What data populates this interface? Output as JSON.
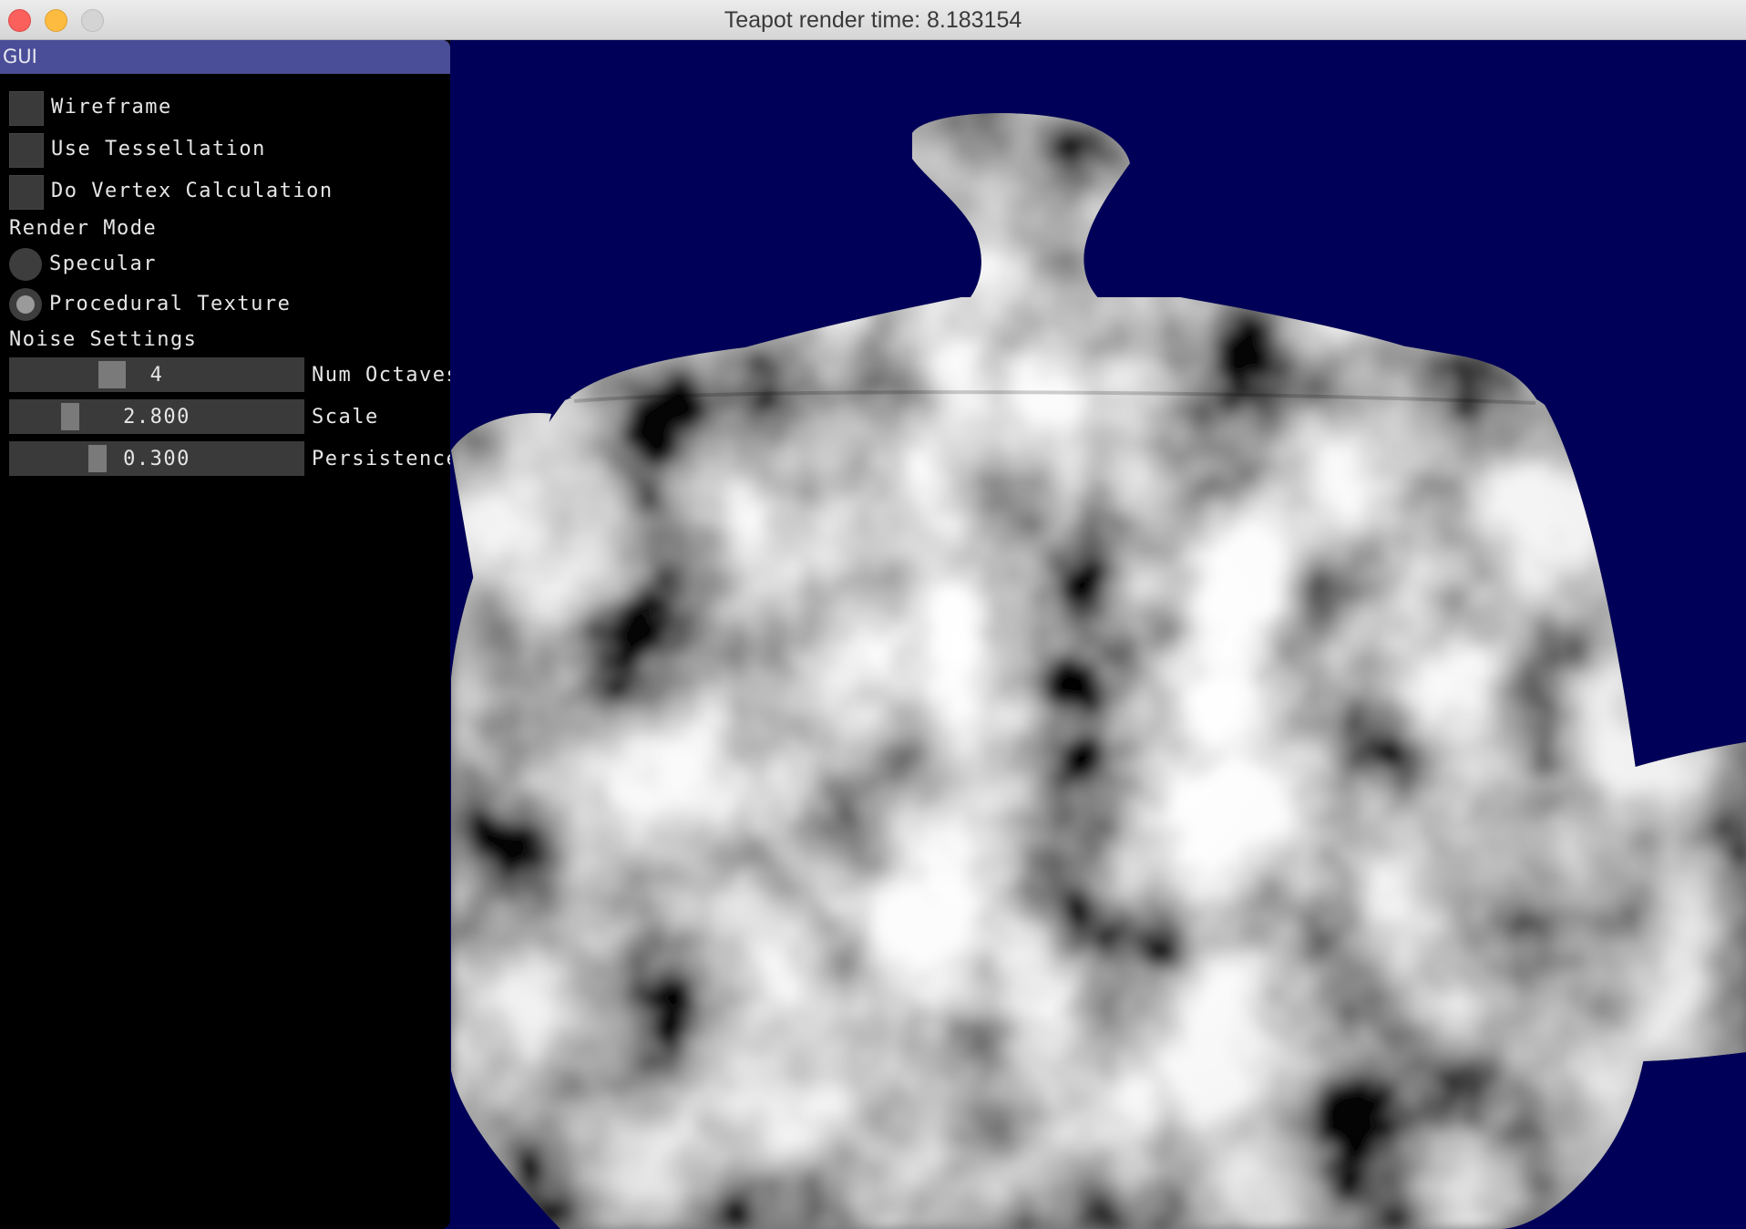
{
  "window": {
    "title": "Teapot render time: 8.183154",
    "background_color": "#000058"
  },
  "gui": {
    "header": "GUI",
    "checkboxes": [
      {
        "label": "Wireframe",
        "checked": false
      },
      {
        "label": "Use Tessellation",
        "checked": false
      },
      {
        "label": "Do Vertex Calculation",
        "checked": false
      }
    ],
    "render_mode": {
      "label": "Render Mode",
      "options": [
        {
          "label": "Specular",
          "selected": false
        },
        {
          "label": "Procedural Texture",
          "selected": true
        }
      ]
    },
    "noise_settings": {
      "label": "Noise Settings",
      "sliders": [
        {
          "label": "Num Octaves",
          "value": "4",
          "fraction": 0.33
        },
        {
          "label": "Scale",
          "value": "2.800",
          "fraction": 0.18
        },
        {
          "label": "Persistence",
          "value": "0.300",
          "fraction": 0.28
        }
      ]
    }
  },
  "viewport": {
    "object": "teapot",
    "texture": "procedural-noise"
  }
}
